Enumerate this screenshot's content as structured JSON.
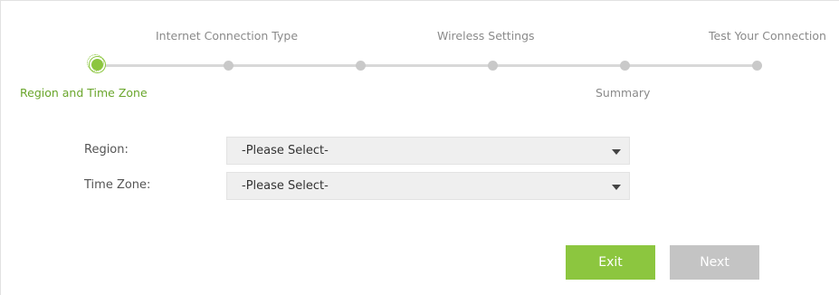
{
  "wizard": {
    "steps": [
      {
        "label": "Region and Time Zone",
        "active": true
      },
      {
        "label": "Internet Connection Type",
        "active": false
      },
      {
        "label": "",
        "active": false
      },
      {
        "label": "Wireless Settings",
        "active": false
      },
      {
        "label": "Summary",
        "active": false
      },
      {
        "label": "Test Your Connection",
        "active": false
      }
    ]
  },
  "form": {
    "region": {
      "label": "Region:",
      "value": "-Please Select-"
    },
    "time_zone": {
      "label": "Time Zone:",
      "value": "-Please Select-"
    }
  },
  "buttons": {
    "exit_label": "Exit",
    "next_label": "Next"
  },
  "colors": {
    "accent": "#8cc63f",
    "active_text": "#6aa62c",
    "disabled_button": "#c4c4c4"
  }
}
